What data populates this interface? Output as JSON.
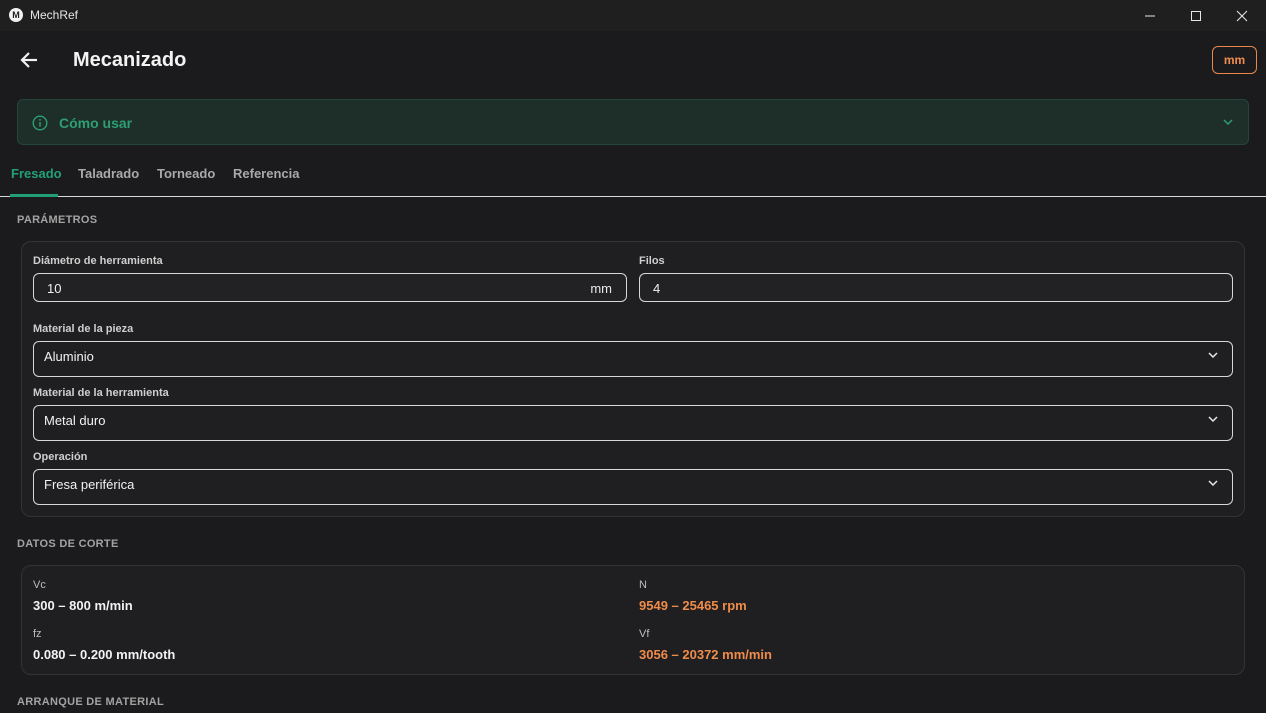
{
  "window": {
    "title": "MechRef",
    "logo_letter": "M",
    "controls": [
      "minimize-icon",
      "maximize-icon",
      "close-icon"
    ]
  },
  "header": {
    "title": "Mecanizado",
    "unit_toggle": "mm"
  },
  "howto": {
    "label": "Cómo usar"
  },
  "tabs": [
    {
      "label": "Fresado",
      "active": true
    },
    {
      "label": "Taladrado",
      "active": false
    },
    {
      "label": "Torneado",
      "active": false
    },
    {
      "label": "Referencia",
      "active": false
    }
  ],
  "parameters": {
    "section_title": "PARÁMETROS",
    "tool_diameter": {
      "label": "Diámetro de herramienta",
      "value": "10",
      "unit": "mm"
    },
    "flutes": {
      "label": "Filos",
      "value": "4"
    },
    "workpiece_material": {
      "label": "Material de la pieza",
      "value": "Aluminio"
    },
    "tool_material": {
      "label": "Material de la herramienta",
      "value": "Metal duro"
    },
    "operation": {
      "label": "Operación",
      "value": "Fresa periférica"
    }
  },
  "cutting_data": {
    "section_title": "DATOS DE CORTE",
    "vc": {
      "label": "Vc",
      "value": "300 – 800  m/min"
    },
    "n": {
      "label": "N",
      "value": "9549 – 25465  rpm"
    },
    "fz": {
      "label": "fz",
      "value": "0.080 – 0.200  mm/tooth"
    },
    "vf": {
      "label": "Vf",
      "value": "3056 – 20372  mm/min"
    }
  },
  "material_removal": {
    "section_title": "ARRANQUE DE MATERIAL"
  },
  "colors": {
    "accent_green": "#21a077",
    "accent_orange": "#f08c4a",
    "background": "#1b1b1d"
  }
}
